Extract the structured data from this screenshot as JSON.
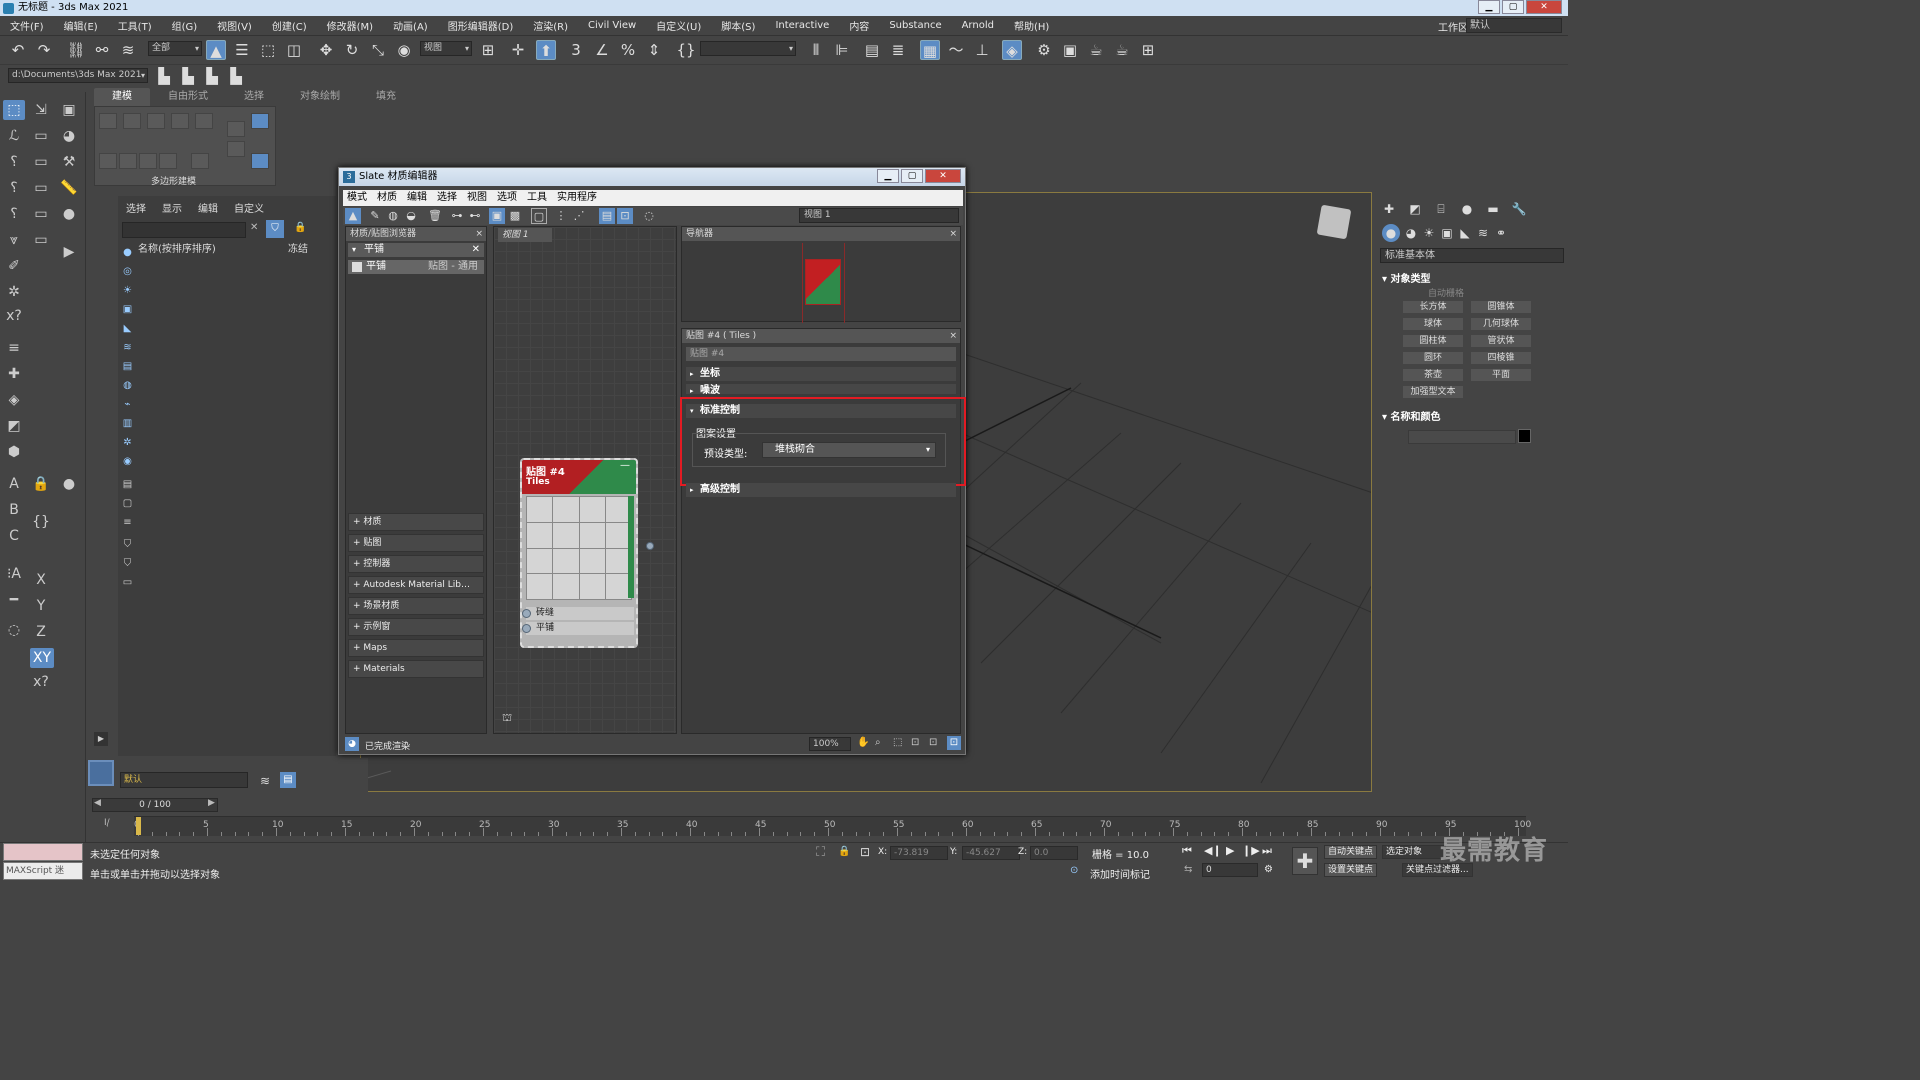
{
  "window": {
    "title": "无标题 - 3ds Max 2021",
    "min": "▁",
    "max": "▢",
    "close": "✕"
  },
  "menu": [
    "文件(F)",
    "编辑(E)",
    "工具(T)",
    "组(G)",
    "视图(V)",
    "创建(C)",
    "修改器(M)",
    "动画(A)",
    "图形编辑器(D)",
    "渲染(R)",
    "Civil View",
    "自定义(U)",
    "脚本(S)",
    "Interactive",
    "内容",
    "Substance",
    "Arnold",
    "帮助(H)"
  ],
  "workspace": {
    "label": "工作区:",
    "value": "默认"
  },
  "toolbar": {
    "filter_value": "全部",
    "refcoord_value": "视图"
  },
  "toolbar2": {
    "path": "d:\\Documents\\3ds Max 2021"
  },
  "ribbon": {
    "tabs": [
      "建模",
      "自由形式",
      "选择",
      "对象绘制",
      "填充"
    ],
    "panel_label": "多边形建模"
  },
  "scene_explorer": {
    "menu": [
      "选择",
      "显示",
      "编辑",
      "自定义"
    ],
    "col_name": "名称(按排序排序)",
    "col_frozen": "冻结"
  },
  "command_panel": {
    "dropdown": "标准基本体",
    "object_type_header": "对象类型",
    "autogrid": "自动栅格",
    "buttons": [
      "长方体",
      "圆锥体",
      "球体",
      "几何球体",
      "圆柱体",
      "管状体",
      "圆环",
      "四棱锥",
      "茶壶",
      "平面",
      "加强型文本"
    ],
    "name_color_header": "名称和颜色",
    "object_color": "#000000"
  },
  "slate": {
    "title": "Slate 材质编辑器",
    "menu": [
      "模式",
      "材质",
      "编辑",
      "选择",
      "视图",
      "选项",
      "工具",
      "实用程序"
    ],
    "view_dropdown": "视图 1",
    "browser": {
      "title": "材质/贴图浏览器",
      "group": "平铺",
      "item": "平铺",
      "item_sub": "贴图 - 通用",
      "rollouts": [
        "+ 材质",
        "+ 贴图",
        "+ 控制器",
        "+ Autodesk Material Lib…",
        "+ 场景材质",
        "+ 示例窗",
        "+ Maps",
        "+ Materials"
      ]
    },
    "view_tab": "视图 1",
    "node": {
      "title": "贴图 #4",
      "subtitle": "Tiles",
      "slots": [
        "砖缝",
        "平铺"
      ],
      "minimize": "—"
    },
    "navigator": {
      "title": "导航器"
    },
    "params": {
      "title": "贴图 #4  ( Tiles )",
      "map_name": "贴图 #4",
      "rollouts": {
        "coords": "坐标",
        "noise": "噪波",
        "std": "标准控制",
        "adv": "高级控制"
      },
      "pattern_group": "图案设置",
      "preset_label": "预设类型:",
      "preset_value": "堆栈砌合"
    },
    "status": "已完成渲染",
    "zoom": "100%"
  },
  "timeline": {
    "frame": "0 / 100",
    "ticks": [
      0,
      5,
      10,
      15,
      20,
      25,
      30,
      35,
      40,
      45,
      50,
      55,
      60,
      65,
      70,
      75,
      80,
      85,
      90,
      95,
      100
    ]
  },
  "status": {
    "layer": "默认",
    "line1": "未选定任何对象",
    "line2": "单击或单击并拖动以选择对象",
    "x_label": "X:",
    "x": "-73.819",
    "y_label": "Y:",
    "y": "-45.627",
    "z_label": "Z:",
    "z": "0.0",
    "grid": "栅格 = 10.0",
    "add_time_tag": "添加时间标记",
    "auto_key": "自动关键点",
    "set_key": "设置关键点",
    "selected": "选定对象",
    "key_filters": "关键点过滤器...",
    "frame_field": "0",
    "maxscript": "MAXScript 迷"
  },
  "watermark": "最需教育"
}
